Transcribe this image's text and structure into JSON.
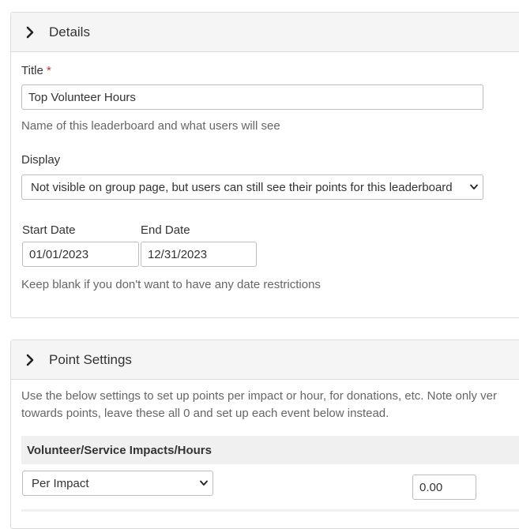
{
  "details": {
    "header": "Details",
    "title_label": "Title",
    "required_mark": "*",
    "title_value": "Top Volunteer Hours",
    "title_help": "Name of this leaderboard and what users will see",
    "display_label": "Display",
    "display_value": "Not visible on group page, but users can still see their points for this leaderboard",
    "start_label": "Start Date",
    "end_label": "End Date",
    "start_value": "01/01/2023",
    "end_value": "12/31/2023",
    "date_help": "Keep blank if you don't want to have any date restrictions"
  },
  "points": {
    "header": "Point Settings",
    "intro_line1": "Use the below settings to set up points per impact or hour, for donations, etc. Note only ver",
    "intro_line2": "towards points, leave these all 0 and set up each event below instead.",
    "volunteer_section": "Volunteer/Service Impacts/Hours",
    "per_value": "Per Impact",
    "amount_value": "0.00"
  }
}
